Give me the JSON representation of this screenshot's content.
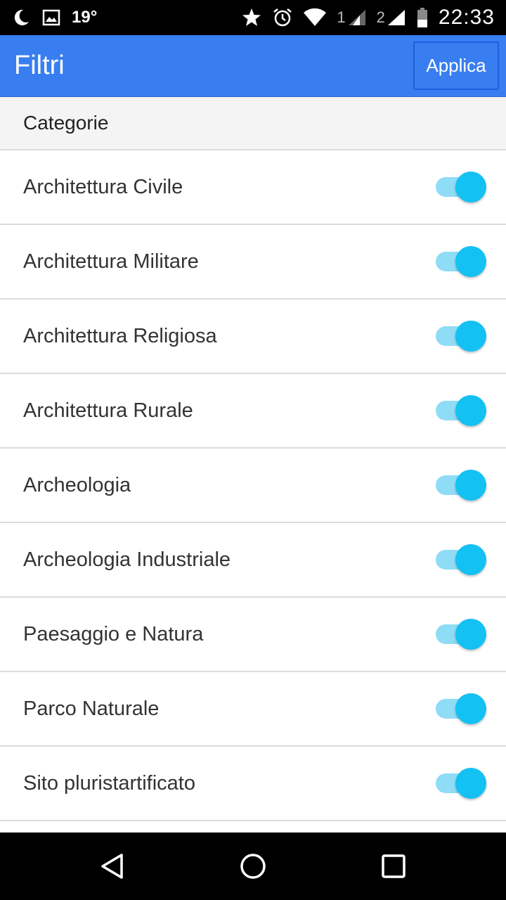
{
  "status_bar": {
    "temperature": "19°",
    "sim1": "1",
    "sim2": "2",
    "time": "22:33",
    "icons": [
      "moon-icon",
      "image-icon",
      "star-icon",
      "alarm-icon",
      "wifi-icon",
      "signal-icon",
      "signal-icon",
      "battery-icon"
    ]
  },
  "appbar": {
    "title": "Filtri",
    "apply_label": "Applica",
    "color": "#387ef0"
  },
  "section": {
    "header": "Categorie"
  },
  "categories": [
    {
      "label": "Architettura Civile",
      "enabled": true
    },
    {
      "label": "Architettura Militare",
      "enabled": true
    },
    {
      "label": "Architettura Religiosa",
      "enabled": true
    },
    {
      "label": "Architettura Rurale",
      "enabled": true
    },
    {
      "label": "Archeologia",
      "enabled": true
    },
    {
      "label": "Archeologia Industriale",
      "enabled": true
    },
    {
      "label": "Paesaggio e Natura",
      "enabled": true
    },
    {
      "label": "Parco Naturale",
      "enabled": true
    },
    {
      "label": "Sito pluristartificato",
      "enabled": true
    }
  ],
  "toggle_colors": {
    "track": "#8fdcf6",
    "knob": "#13c1f3"
  },
  "navbar": {
    "icons": [
      "back-icon",
      "home-icon",
      "recents-icon"
    ]
  }
}
